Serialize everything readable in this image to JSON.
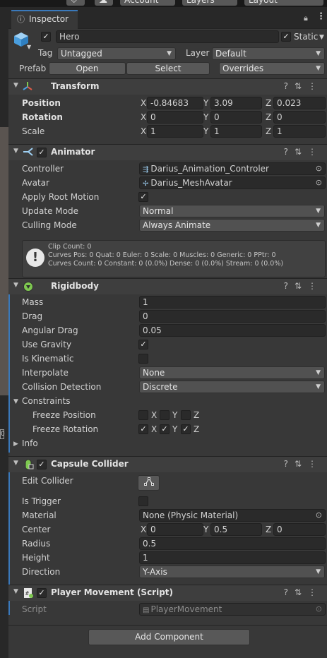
{
  "window": {
    "tab_title": "Inspector",
    "top_buttons": [
      "Account",
      "Layers",
      "Layout"
    ]
  },
  "gameobject": {
    "name": "Hero",
    "active": true,
    "static_label": "Static",
    "static": true,
    "tag_label": "Tag",
    "tag": "Untagged",
    "layer_label": "Layer",
    "layer": "Default",
    "prefab_label": "Prefab",
    "open_label": "Open",
    "select_label": "Select",
    "overrides_label": "Overrides"
  },
  "transform": {
    "title": "Transform",
    "position_label": "Position",
    "rotation_label": "Rotation",
    "scale_label": "Scale",
    "position": {
      "x": "-0.84683",
      "y": "3.09",
      "z": "0.023"
    },
    "rotation": {
      "x": "0",
      "y": "0",
      "z": "0"
    },
    "scale": {
      "x": "1",
      "y": "1",
      "z": "1"
    },
    "axis_x": "X",
    "axis_y": "Y",
    "axis_z": "Z"
  },
  "animator": {
    "title": "Animator",
    "enabled": true,
    "controller_label": "Controller",
    "controller": "Darius_Animation_Controler",
    "avatar_label": "Avatar",
    "avatar": "Darius_MeshAvatar",
    "apply_root_motion_label": "Apply Root Motion",
    "apply_root_motion": true,
    "update_mode_label": "Update Mode",
    "update_mode": "Normal",
    "culling_mode_label": "Culling Mode",
    "culling_mode": "Always Animate",
    "info_line1": "Clip Count: 0",
    "info_line2": "Curves Pos: 0 Quat: 0 Euler: 0 Scale: 0 Muscles: 0 Generic: 0 PPtr: 0",
    "info_line3": "Curves Count: 0 Constant: 0 (0.0%) Dense: 0 (0.0%) Stream: 0 (0.0%)"
  },
  "rigidbody": {
    "title": "Rigidbody",
    "mass_label": "Mass",
    "mass": "1",
    "drag_label": "Drag",
    "drag": "0",
    "angular_drag_label": "Angular Drag",
    "angular_drag": "0.05",
    "use_gravity_label": "Use Gravity",
    "use_gravity": true,
    "is_kinematic_label": "Is Kinematic",
    "is_kinematic": false,
    "interpolate_label": "Interpolate",
    "interpolate": "None",
    "collision_detection_label": "Collision Detection",
    "collision_detection": "Discrete",
    "constraints_label": "Constraints",
    "freeze_position_label": "Freeze Position",
    "freeze_rotation_label": "Freeze Rotation",
    "freeze_position": {
      "x": false,
      "y": false,
      "z": false
    },
    "freeze_rotation": {
      "x": true,
      "y": true,
      "z": true
    },
    "info_label": "Info"
  },
  "capsule_collider": {
    "title": "Capsule Collider",
    "enabled": true,
    "edit_collider_label": "Edit Collider",
    "is_trigger_label": "Is Trigger",
    "is_trigger": false,
    "material_label": "Material",
    "material": "None (Physic Material)",
    "center_label": "Center",
    "center": {
      "x": "0",
      "y": "0.5",
      "z": "0"
    },
    "radius_label": "Radius",
    "radius": "0.5",
    "height_label": "Height",
    "height": "1",
    "direction_label": "Direction",
    "direction": "Y-Axis"
  },
  "player_movement": {
    "title": "Player Movement (Script)",
    "enabled": true,
    "script_label": "Script",
    "script": "PlayerMovement"
  },
  "add_component_label": "Add Component",
  "icons": {
    "help": "help-icon",
    "presets": "presets-icon",
    "more": "more-icon"
  },
  "colors": {
    "background": "#383838",
    "accent": "#3a79bb",
    "field": "#2a2a2a"
  }
}
